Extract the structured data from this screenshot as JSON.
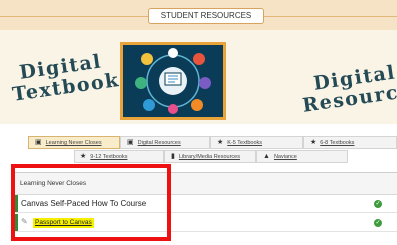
{
  "header": {
    "title": "STUDENT RESOURCES",
    "left_heading": [
      "Digital",
      "Textbooks"
    ],
    "right_heading": [
      "Digital",
      "Resources"
    ]
  },
  "tabs": [
    {
      "label": "Learning Never Closes",
      "icon": "laptop-icon",
      "active": true
    },
    {
      "label": "Digital Resources",
      "icon": "laptop-icon",
      "active": false
    },
    {
      "label": "K-5 Textbooks",
      "icon": "star-icon",
      "active": false
    },
    {
      "label": "6-8 Textbooks",
      "icon": "star-icon",
      "active": false
    },
    {
      "label": "9-12 Textbooks",
      "icon": "star-icon",
      "active": false
    },
    {
      "label": "Library/Media Resources",
      "icon": "book-icon",
      "active": false
    },
    {
      "label": "Naviance",
      "icon": "compass-icon",
      "active": false
    }
  ],
  "panel": {
    "header": "Learning Never Closes",
    "items": [
      {
        "label": "Canvas Self-Paced How To Course",
        "status_icon": "check-circle-icon"
      },
      {
        "label": "Passport to Canvas",
        "icon": "pencil-icon",
        "status_icon": "check-circle-icon"
      }
    ]
  },
  "colors": {
    "accent_band": "#f6e2c4",
    "highlight": "#f4f000",
    "annotation": "#ee1111",
    "module_accent": "#2e8b3a"
  }
}
